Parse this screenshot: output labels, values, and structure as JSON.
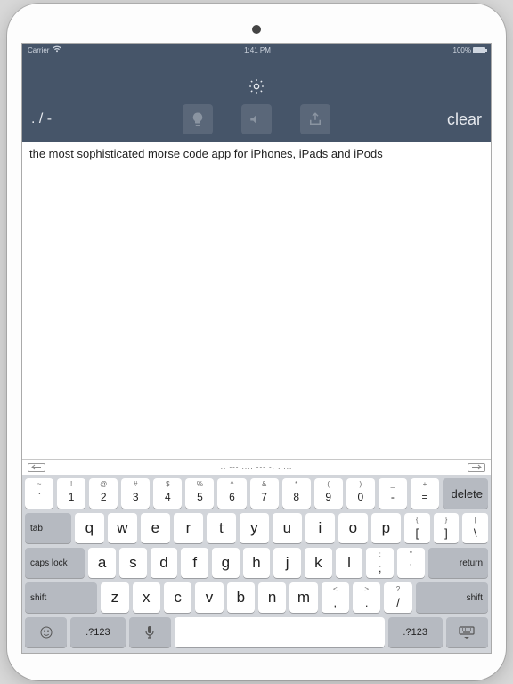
{
  "statusbar": {
    "carrier": "Carrier",
    "wifi": "􀙇",
    "time": "1:41 PM",
    "battery": "100%"
  },
  "header": {
    "mode_label": ". / -",
    "clear_label": "clear"
  },
  "textarea": {
    "value": "the most sophisticated morse code app for iPhones, iPads and iPods"
  },
  "morse_bar": {
    "output": ".. --- .... --- -. . ..."
  },
  "keyboard": {
    "numrow": [
      {
        "sub": "~",
        "main": "`"
      },
      {
        "sub": "!",
        "main": "1"
      },
      {
        "sub": "@",
        "main": "2"
      },
      {
        "sub": "#",
        "main": "3"
      },
      {
        "sub": "$",
        "main": "4"
      },
      {
        "sub": "%",
        "main": "5"
      },
      {
        "sub": "^",
        "main": "6"
      },
      {
        "sub": "&",
        "main": "7"
      },
      {
        "sub": "*",
        "main": "8"
      },
      {
        "sub": "(",
        "main": "9"
      },
      {
        "sub": ")",
        "main": "0"
      },
      {
        "sub": "_",
        "main": "-"
      },
      {
        "sub": "+",
        "main": "="
      }
    ],
    "delete": "delete",
    "tab": "tab",
    "row_q": [
      "q",
      "w",
      "e",
      "r",
      "t",
      "y",
      "u",
      "i",
      "o",
      "p"
    ],
    "brackets": [
      {
        "sub": "{",
        "main": "["
      },
      {
        "sub": "}",
        "main": "]"
      },
      {
        "sub": "|",
        "main": "\\"
      }
    ],
    "caps": "caps lock",
    "row_a": [
      "a",
      "s",
      "d",
      "f",
      "g",
      "h",
      "j",
      "k",
      "l"
    ],
    "semicolon": {
      "sub": ":",
      "main": ";"
    },
    "quote": {
      "sub": "\"",
      "main": "'"
    },
    "return": "return",
    "shift": "shift",
    "row_z": [
      "z",
      "x",
      "c",
      "v",
      "b",
      "n",
      "m"
    ],
    "comma": {
      "sub": "<",
      "main": ","
    },
    "period": {
      "sub": ">",
      "main": "."
    },
    "slash": {
      "sub": "?",
      "main": "/"
    },
    "sym": ".?123"
  }
}
